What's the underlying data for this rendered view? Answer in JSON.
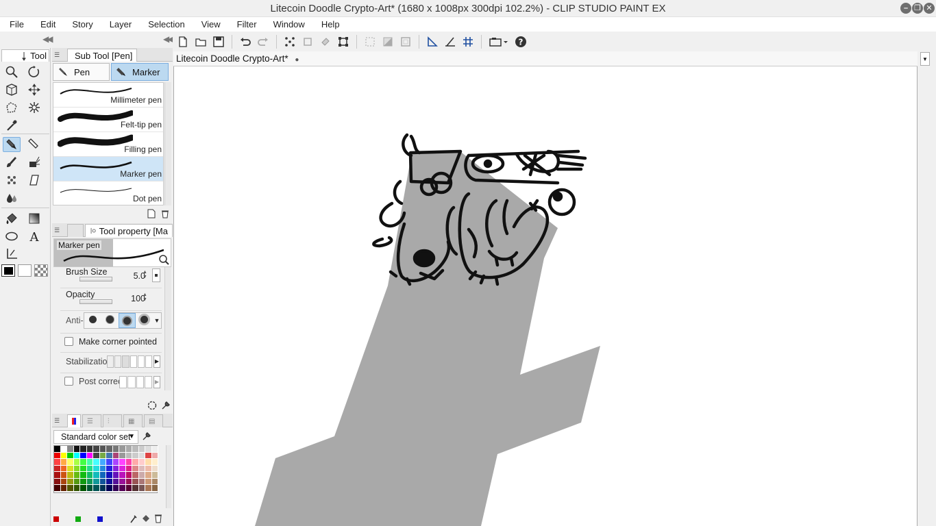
{
  "window": {
    "title": "Litecoin Doodle Crypto-Art* (1680 x 1008px 300dpi 102.2%)  - CLIP STUDIO PAINT EX"
  },
  "menu": [
    "File",
    "Edit",
    "Story",
    "Layer",
    "Selection",
    "View",
    "Filter",
    "Window",
    "Help"
  ],
  "tool_panel": {
    "tab_label": "Tool"
  },
  "subtool_panel": {
    "tab_label": "Sub Tool [Pen]",
    "groups": [
      "Pen",
      "Marker"
    ],
    "active_group": "Marker",
    "brushes": [
      "Millimeter pen",
      "Felt-tip pen",
      "Filling pen",
      "Marker pen",
      "Dot pen"
    ],
    "active_brush": "Marker pen"
  },
  "tool_property": {
    "tab_label": "Tool property [Ma",
    "preview_label": "Marker pen",
    "brush_size_label": "Brush Size",
    "brush_size_value": "5.0",
    "opacity_label": "Opacity",
    "opacity_value": "100",
    "anti_alias_label": "Anti-",
    "make_corner_label": "Make corner pointed",
    "stabilization_label": "Stabilizatio",
    "post_correction_label": "Post correc"
  },
  "color_set": {
    "dropdown_value": "Standard color set"
  },
  "document": {
    "tab_label": "Litecoin Doodle Crypto-Art*"
  },
  "colors": {
    "accent": "#bcd9f0",
    "canvas_gray": "#a9a9a9",
    "line": "#111111"
  }
}
